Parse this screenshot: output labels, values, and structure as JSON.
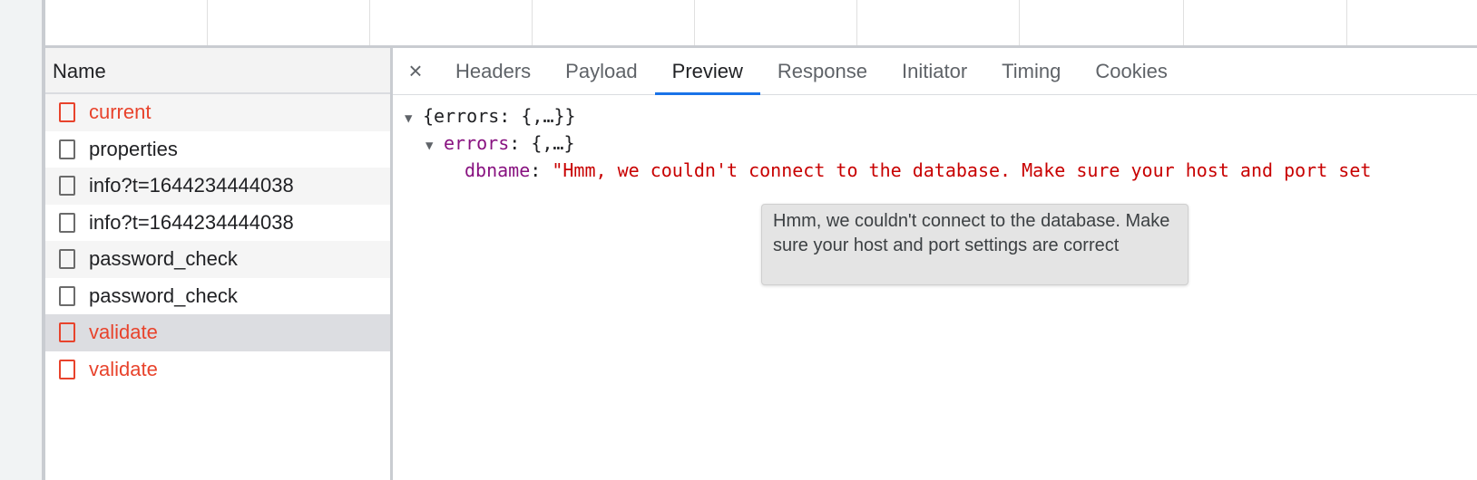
{
  "name_panel": {
    "header": "Name",
    "requests": [
      {
        "name": "current",
        "status": "error"
      },
      {
        "name": "properties",
        "status": "ok"
      },
      {
        "name": "info?t=1644234444038",
        "status": "ok"
      },
      {
        "name": "info?t=1644234444038",
        "status": "ok"
      },
      {
        "name": "password_check",
        "status": "ok"
      },
      {
        "name": "password_check",
        "status": "ok"
      },
      {
        "name": "validate",
        "status": "error"
      },
      {
        "name": "validate",
        "status": "error"
      }
    ]
  },
  "detail": {
    "close_symbol": "×",
    "tabs": [
      "Headers",
      "Payload",
      "Preview",
      "Response",
      "Initiator",
      "Timing",
      "Cookies"
    ],
    "active_tab": "Preview",
    "preview": {
      "root": "{errors: {,…}}",
      "errors_key": "errors",
      "errors_summary": "{,…}",
      "dbname_key": "dbname",
      "dbname_value": "\"Hmm, we couldn't connect to the database. Make sure your host and port set"
    }
  },
  "tooltip": {
    "text": "Hmm, we couldn't connect to the database. Make sure your host and port settings are correct"
  },
  "colors": {
    "error_text": "#e8432c",
    "active_tab_underline": "#1a73e8",
    "json_key": "#881280",
    "json_string": "#c80000"
  },
  "icons": {
    "close": "close-icon",
    "expand": "triangle-down-icon",
    "request_file": "document-icon"
  }
}
